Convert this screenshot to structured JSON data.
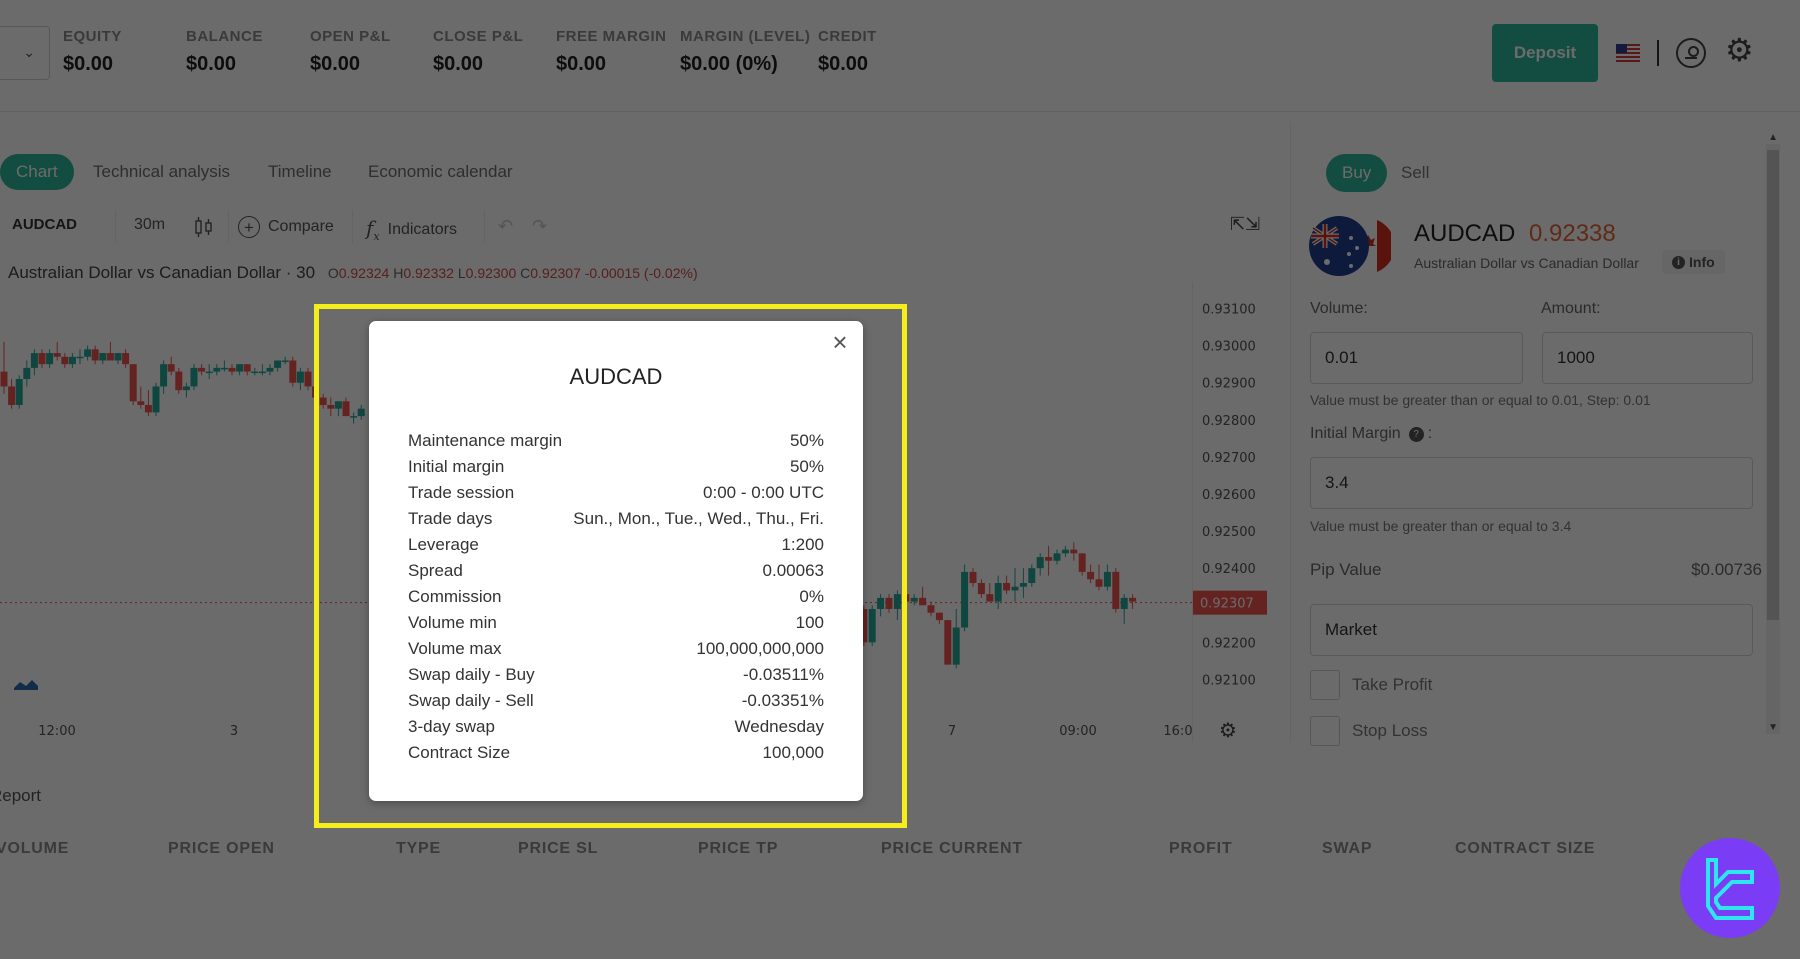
{
  "topbar": {
    "stats": [
      {
        "label": "EQUITY",
        "value": "$0.00"
      },
      {
        "label": "BALANCE",
        "value": "$0.00"
      },
      {
        "label": "OPEN P&L",
        "value": "$0.00"
      },
      {
        "label": "CLOSE P&L",
        "value": "$0.00"
      },
      {
        "label": "FREE MARGIN",
        "value": "$0.00"
      },
      {
        "label": "MARGIN (LEVEL)",
        "value": "$0.00 (0%)"
      },
      {
        "label": "CREDIT",
        "value": "$0.00"
      }
    ],
    "deposit_label": "Deposit",
    "icons": {
      "account_dropdown": "chevron-down-icon",
      "language": "us-flag-icon",
      "profile": "user-icon",
      "settings": "gear-icon"
    }
  },
  "chart_tabs": [
    {
      "label": "Chart",
      "active": true
    },
    {
      "label": "Technical analysis",
      "active": false
    },
    {
      "label": "Timeline",
      "active": false
    },
    {
      "label": "Economic calendar",
      "active": false
    }
  ],
  "toolbar": {
    "symbol": "AUDCAD",
    "interval": "30m",
    "compare_label": "Compare",
    "indicators_label": "Indicators",
    "fx_glyph": "f",
    "fx_sub": "x"
  },
  "chart_legend": {
    "title": "Australian Dollar vs Canadian Dollar · 30",
    "open": "0.92324",
    "high": "0.92332",
    "low": "0.92300",
    "close": "0.92307",
    "change": "-0.00015 (-0.02%)",
    "o_prefix": "O",
    "h_prefix": "H",
    "l_prefix": "L",
    "c_prefix": "C"
  },
  "chart_data": {
    "type": "candlestick",
    "title": "Australian Dollar vs Canadian Dollar · 30",
    "ylim": [
      0.9205,
      0.9315
    ],
    "y_ticks": [
      "0.93100",
      "0.93000",
      "0.92900",
      "0.92800",
      "0.92700",
      "0.92600",
      "0.92500",
      "0.92400",
      "0.92300",
      "0.92200",
      "0.92100"
    ],
    "x_ticks": [
      "12:00",
      "3",
      "7",
      "09:00",
      "16:0"
    ],
    "last_price": "0.92307",
    "colors": {
      "up": "#26a69a",
      "down": "#ef5350",
      "last_price_line": "#ef5350"
    },
    "visible_candles_left": [
      {
        "o": 0.9293,
        "h": 0.9301,
        "l": 0.9287,
        "c": 0.9289
      },
      {
        "o": 0.9289,
        "h": 0.9291,
        "l": 0.9283,
        "c": 0.9284
      },
      {
        "o": 0.9284,
        "h": 0.9292,
        "l": 0.9283,
        "c": 0.9291
      },
      {
        "o": 0.9291,
        "h": 0.9296,
        "l": 0.9289,
        "c": 0.9294
      },
      {
        "o": 0.9294,
        "h": 0.9299,
        "l": 0.9292,
        "c": 0.9298
      },
      {
        "o": 0.9298,
        "h": 0.9299,
        "l": 0.9294,
        "c": 0.9295
      },
      {
        "o": 0.9295,
        "h": 0.9299,
        "l": 0.9294,
        "c": 0.9298
      },
      {
        "o": 0.9298,
        "h": 0.9301,
        "l": 0.9296,
        "c": 0.9297
      },
      {
        "o": 0.9297,
        "h": 0.9298,
        "l": 0.9294,
        "c": 0.9295
      },
      {
        "o": 0.9295,
        "h": 0.9298,
        "l": 0.9294,
        "c": 0.9297
      },
      {
        "o": 0.9297,
        "h": 0.9299,
        "l": 0.9295,
        "c": 0.9297
      },
      {
        "o": 0.9297,
        "h": 0.93,
        "l": 0.9296,
        "c": 0.9299
      },
      {
        "o": 0.9299,
        "h": 0.93,
        "l": 0.9295,
        "c": 0.9296
      },
      {
        "o": 0.9296,
        "h": 0.9298,
        "l": 0.9295,
        "c": 0.9298
      },
      {
        "o": 0.9298,
        "h": 0.9301,
        "l": 0.9296,
        "c": 0.9296
      },
      {
        "o": 0.9296,
        "h": 0.9298,
        "l": 0.9295,
        "c": 0.9298
      },
      {
        "o": 0.9298,
        "h": 0.9299,
        "l": 0.9294,
        "c": 0.9295
      },
      {
        "o": 0.9295,
        "h": 0.9295,
        "l": 0.9284,
        "c": 0.9285
      },
      {
        "o": 0.9285,
        "h": 0.9289,
        "l": 0.9283,
        "c": 0.9284
      },
      {
        "o": 0.9284,
        "h": 0.9288,
        "l": 0.9281,
        "c": 0.9282
      },
      {
        "o": 0.9282,
        "h": 0.929,
        "l": 0.9281,
        "c": 0.9289
      },
      {
        "o": 0.9289,
        "h": 0.9296,
        "l": 0.9287,
        "c": 0.9295
      },
      {
        "o": 0.9295,
        "h": 0.9297,
        "l": 0.9292,
        "c": 0.9293
      },
      {
        "o": 0.9293,
        "h": 0.9294,
        "l": 0.9287,
        "c": 0.9288
      },
      {
        "o": 0.9288,
        "h": 0.929,
        "l": 0.9286,
        "c": 0.9289
      },
      {
        "o": 0.9289,
        "h": 0.9295,
        "l": 0.9288,
        "c": 0.9294
      },
      {
        "o": 0.9294,
        "h": 0.9295,
        "l": 0.9292,
        "c": 0.9293
      },
      {
        "o": 0.9293,
        "h": 0.9295,
        "l": 0.9291,
        "c": 0.9293
      },
      {
        "o": 0.9293,
        "h": 0.9295,
        "l": 0.9292,
        "c": 0.9294
      },
      {
        "o": 0.9294,
        "h": 0.9296,
        "l": 0.9293,
        "c": 0.9294
      },
      {
        "o": 0.9294,
        "h": 0.9295,
        "l": 0.9292,
        "c": 0.9293
      },
      {
        "o": 0.9293,
        "h": 0.9295,
        "l": 0.9292,
        "c": 0.9295
      },
      {
        "o": 0.9295,
        "h": 0.9295,
        "l": 0.9292,
        "c": 0.9293
      },
      {
        "o": 0.9293,
        "h": 0.9294,
        "l": 0.9292,
        "c": 0.9293
      },
      {
        "o": 0.9293,
        "h": 0.9295,
        "l": 0.9292,
        "c": 0.9293
      },
      {
        "o": 0.9293,
        "h": 0.9295,
        "l": 0.9292,
        "c": 0.9294
      },
      {
        "o": 0.9294,
        "h": 0.9296,
        "l": 0.9293,
        "c": 0.9296
      },
      {
        "o": 0.9296,
        "h": 0.9297,
        "l": 0.9295,
        "c": 0.9296
      },
      {
        "o": 0.9296,
        "h": 0.9297,
        "l": 0.9289,
        "c": 0.929
      },
      {
        "o": 0.929,
        "h": 0.9294,
        "l": 0.9288,
        "c": 0.9293
      },
      {
        "o": 0.9293,
        "h": 0.9294,
        "l": 0.9288,
        "c": 0.9289
      },
      {
        "o": 0.9289,
        "h": 0.9291,
        "l": 0.9279,
        "c": 0.9286
      },
      {
        "o": 0.9286,
        "h": 0.9287,
        "l": 0.9283,
        "c": 0.9284
      },
      {
        "o": 0.9284,
        "h": 0.9286,
        "l": 0.9281,
        "c": 0.9283
      },
      {
        "o": 0.9283,
        "h": 0.9285,
        "l": 0.9281,
        "c": 0.9285
      },
      {
        "o": 0.9285,
        "h": 0.9286,
        "l": 0.9281,
        "c": 0.9281
      },
      {
        "o": 0.9281,
        "h": 0.9282,
        "l": 0.9279,
        "c": 0.9281
      },
      {
        "o": 0.9281,
        "h": 0.9284,
        "l": 0.928,
        "c": 0.9283
      }
    ],
    "visible_candles_right": [
      {
        "o": 0.9231,
        "h": 0.9233,
        "l": 0.9224,
        "c": 0.9226
      },
      {
        "o": 0.9226,
        "h": 0.923,
        "l": 0.9225,
        "c": 0.9229
      },
      {
        "o": 0.9229,
        "h": 0.923,
        "l": 0.9219,
        "c": 0.922
      },
      {
        "o": 0.922,
        "h": 0.923,
        "l": 0.9219,
        "c": 0.9229
      },
      {
        "o": 0.9229,
        "h": 0.9233,
        "l": 0.9227,
        "c": 0.9232
      },
      {
        "o": 0.9232,
        "h": 0.9233,
        "l": 0.9228,
        "c": 0.9229
      },
      {
        "o": 0.9229,
        "h": 0.9234,
        "l": 0.9226,
        "c": 0.9233
      },
      {
        "o": 0.9233,
        "h": 0.9234,
        "l": 0.923,
        "c": 0.9231
      },
      {
        "o": 0.9231,
        "h": 0.9233,
        "l": 0.923,
        "c": 0.9232
      },
      {
        "o": 0.9232,
        "h": 0.9235,
        "l": 0.923,
        "c": 0.923
      },
      {
        "o": 0.923,
        "h": 0.9231,
        "l": 0.9227,
        "c": 0.9228
      },
      {
        "o": 0.9228,
        "h": 0.9228,
        "l": 0.9225,
        "c": 0.9226
      },
      {
        "o": 0.9226,
        "h": 0.9226,
        "l": 0.9214,
        "c": 0.9214
      },
      {
        "o": 0.9214,
        "h": 0.9229,
        "l": 0.9213,
        "c": 0.9224
      },
      {
        "o": 0.9224,
        "h": 0.9241,
        "l": 0.9223,
        "c": 0.9239
      },
      {
        "o": 0.9239,
        "h": 0.924,
        "l": 0.9235,
        "c": 0.9236
      },
      {
        "o": 0.9236,
        "h": 0.9237,
        "l": 0.9232,
        "c": 0.9233
      },
      {
        "o": 0.9233,
        "h": 0.9236,
        "l": 0.9231,
        "c": 0.9231
      },
      {
        "o": 0.9231,
        "h": 0.9238,
        "l": 0.9229,
        "c": 0.9236
      },
      {
        "o": 0.9236,
        "h": 0.9238,
        "l": 0.9233,
        "c": 0.9234
      },
      {
        "o": 0.9234,
        "h": 0.924,
        "l": 0.9231,
        "c": 0.9235
      },
      {
        "o": 0.9235,
        "h": 0.924,
        "l": 0.9232,
        "c": 0.9236
      },
      {
        "o": 0.9236,
        "h": 0.9241,
        "l": 0.9235,
        "c": 0.924
      },
      {
        "o": 0.924,
        "h": 0.9244,
        "l": 0.9238,
        "c": 0.9243
      },
      {
        "o": 0.9243,
        "h": 0.9246,
        "l": 0.9238,
        "c": 0.9242
      },
      {
        "o": 0.9242,
        "h": 0.9245,
        "l": 0.9241,
        "c": 0.9244
      },
      {
        "o": 0.9244,
        "h": 0.9246,
        "l": 0.9243,
        "c": 0.9245
      },
      {
        "o": 0.9245,
        "h": 0.9247,
        "l": 0.9242,
        "c": 0.9244
      },
      {
        "o": 0.9244,
        "h": 0.9244,
        "l": 0.9238,
        "c": 0.9239
      },
      {
        "o": 0.9239,
        "h": 0.9241,
        "l": 0.9236,
        "c": 0.9237
      },
      {
        "o": 0.9237,
        "h": 0.9241,
        "l": 0.9234,
        "c": 0.9235
      },
      {
        "o": 0.9235,
        "h": 0.9241,
        "l": 0.9234,
        "c": 0.9239
      },
      {
        "o": 0.9239,
        "h": 0.924,
        "l": 0.9228,
        "c": 0.9229
      },
      {
        "o": 0.9229,
        "h": 0.9233,
        "l": 0.9225,
        "c": 0.9232
      },
      {
        "o": 0.9232,
        "h": 0.9233,
        "l": 0.9229,
        "c": 0.9231
      }
    ]
  },
  "order_panel": {
    "tabs": [
      {
        "label": "Buy",
        "active": true
      },
      {
        "label": "Sell",
        "active": false
      }
    ],
    "symbol": "AUDCAD",
    "price": "0.92338",
    "description": "Australian Dollar vs Canadian Dollar",
    "info_label": "Info",
    "volume_label": "Volume:",
    "volume_value": "0.01",
    "amount_label": "Amount:",
    "amount_value": "1000",
    "volume_hint": "Value must be greater than or equal to 0.01, Step: 0.01",
    "initial_margin_label": "Initial Margin",
    "initial_margin_suffix": ":",
    "initial_margin_value": "3.4",
    "initial_margin_hint": "Value must be greater than or equal to 3.4",
    "pip_value_label": "Pip Value",
    "pip_value": "$0.00736",
    "order_type": "Market",
    "take_profit_label": "Take Profit",
    "stop_loss_label": "Stop Loss",
    "colors": {
      "accent": "#2fb59a",
      "price": "#e2663b"
    }
  },
  "report": {
    "title": "Report",
    "columns": [
      "VOLUME",
      "PRICE OPEN",
      "TYPE",
      "PRICE SL",
      "PRICE TP",
      "PRICE CURRENT",
      "PROFIT",
      "SWAP",
      "CONTRACT SIZE"
    ]
  },
  "modal": {
    "title": "AUDCAD",
    "rows": [
      {
        "label": "Maintenance margin",
        "value": "50%"
      },
      {
        "label": "Initial margin",
        "value": "50%"
      },
      {
        "label": "Trade session",
        "value": "0:00 - 0:00 UTC"
      },
      {
        "label": "Trade days",
        "value": "Sun., Mon., Tue., Wed., Thu., Fri."
      },
      {
        "label": "Leverage",
        "value": "1:200"
      },
      {
        "label": "Spread",
        "value": "0.00063"
      },
      {
        "label": "Commission",
        "value": "0%"
      },
      {
        "label": "Volume min",
        "value": "100"
      },
      {
        "label": "Volume max",
        "value": "100,000,000,000"
      },
      {
        "label": "Swap daily - Buy",
        "value": "-0.03511%"
      },
      {
        "label": "Swap daily - Sell",
        "value": "-0.03351%"
      },
      {
        "label": "3-day swap",
        "value": "Wednesday"
      },
      {
        "label": "Contract Size",
        "value": "100,000"
      }
    ],
    "close_glyph": "×"
  },
  "highlight_color": "#f6ee1a"
}
